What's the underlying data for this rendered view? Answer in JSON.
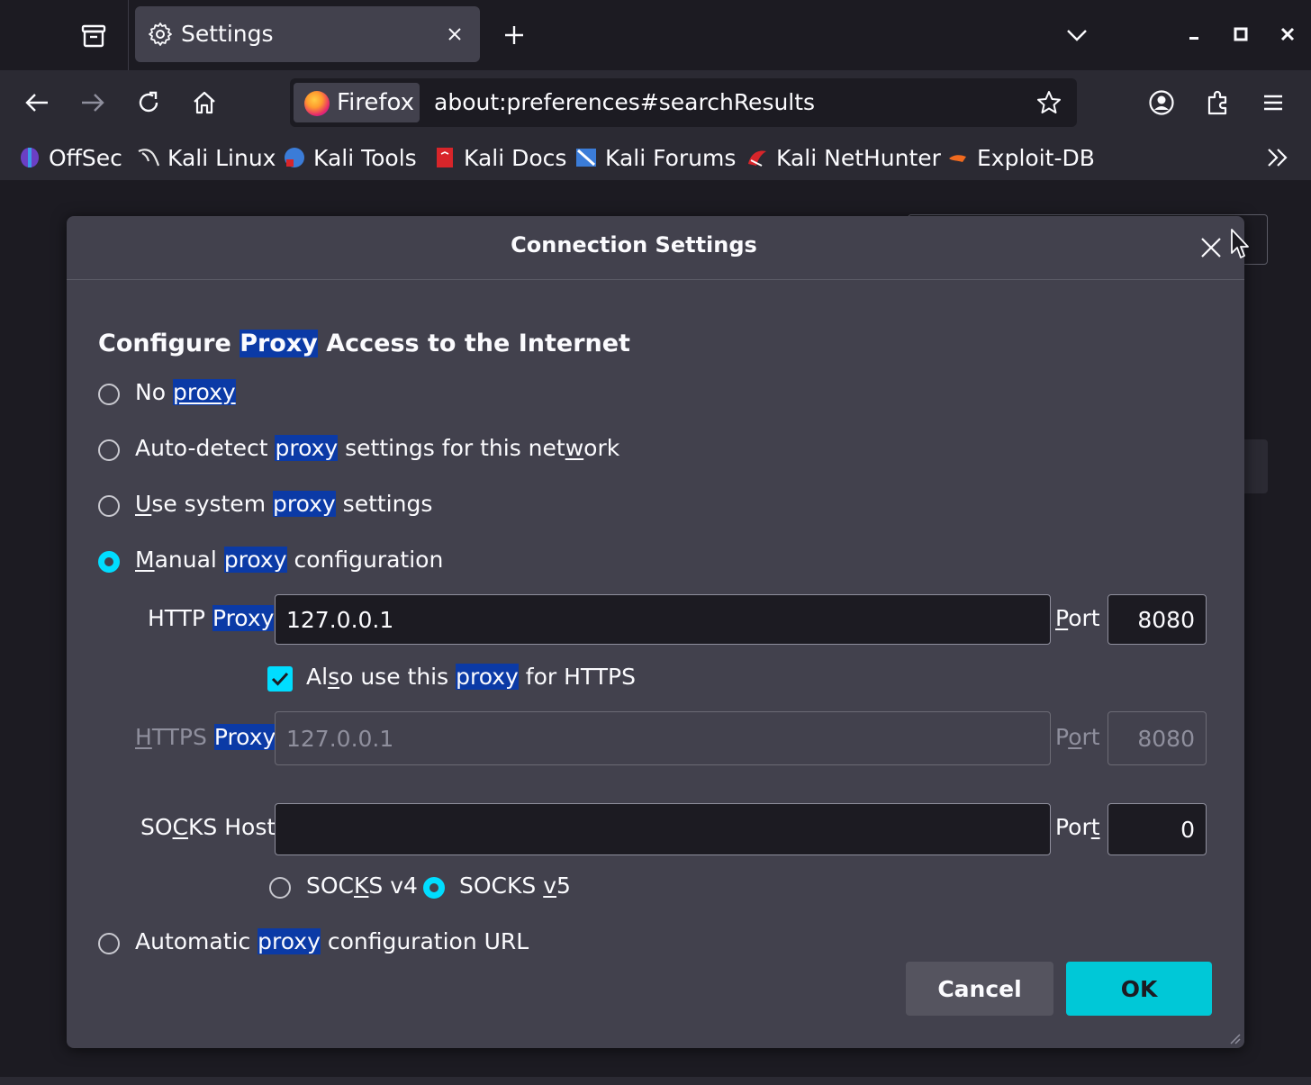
{
  "window": {
    "tab_title": "Settings",
    "identity_label": "Firefox",
    "url": "about:preferences#searchResults"
  },
  "bookmarks": [
    {
      "label": "OffSec",
      "icon": "offsec-icon",
      "color": "#3b6fd8"
    },
    {
      "label": "Kali Linux",
      "icon": "kali-dragon-icon",
      "color": "#e6e6e6"
    },
    {
      "label": "Kali Tools",
      "icon": "kali-tools-icon",
      "color": "#3b7cd8"
    },
    {
      "label": "Kali Docs",
      "icon": "kali-docs-icon",
      "color": "#d8252a"
    },
    {
      "label": "Kali Forums",
      "icon": "kali-forums-icon",
      "color": "#3b7cd8"
    },
    {
      "label": "Kali NetHunter",
      "icon": "kali-nethunter-icon",
      "color": "#d8252a"
    },
    {
      "label": "Exploit-DB",
      "icon": "exploit-db-icon",
      "color": "#f06a1f"
    }
  ],
  "dialog": {
    "title": "Connection Settings",
    "section_title": {
      "pre": "Configure ",
      "hl": "Proxy",
      "post": " Access to the Internet"
    },
    "options": {
      "no_proxy": {
        "pre": "No ",
        "hl": "proxy"
      },
      "auto_detect": {
        "pre": "Auto-detect ",
        "hl": "proxy",
        "post_a": " settings for this net",
        "post_u": "w",
        "post_b": "ork"
      },
      "system": {
        "u": "U",
        "pre": "se system ",
        "hl": "proxy",
        "post": " settings"
      },
      "manual": {
        "u": "M",
        "pre": "anual ",
        "hl": "proxy",
        "post": " configuration"
      },
      "auto_url": {
        "pre": "Automatic ",
        "hl": "proxy",
        "post": " configuration URL"
      }
    },
    "http": {
      "label_pre": "HTTP ",
      "label_hl": "Proxy",
      "value": "127.0.0.1",
      "port_u": "P",
      "port_rest": "ort",
      "port": "8080"
    },
    "also_https": {
      "pre_a": "Al",
      "pre_u": "s",
      "pre_b": "o use this ",
      "hl": "proxy",
      "post": " for HTTPS",
      "checked": true
    },
    "https": {
      "label_u": "H",
      "label_pre": "TTPS ",
      "label_hl": "Proxy",
      "value": "127.0.0.1",
      "port_a": "P",
      "port_u": "o",
      "port_b": "rt",
      "port": "8080"
    },
    "socks": {
      "label_a": "SO",
      "label_u": "C",
      "label_b": "KS Host",
      "value": "",
      "port_a": "Por",
      "port_u": "t",
      "port": "0"
    },
    "socks_v4": {
      "a": "SOC",
      "u": "K",
      "b": "S v4"
    },
    "socks_v5": {
      "a": "SOCKS ",
      "u": "v",
      "b": "5"
    },
    "cancel_label": "Cancel",
    "ok_label": "OK"
  },
  "colors": {
    "accent": "#00ddff",
    "highlight": "#0b3aa6",
    "dialog_bg": "#42414d"
  }
}
